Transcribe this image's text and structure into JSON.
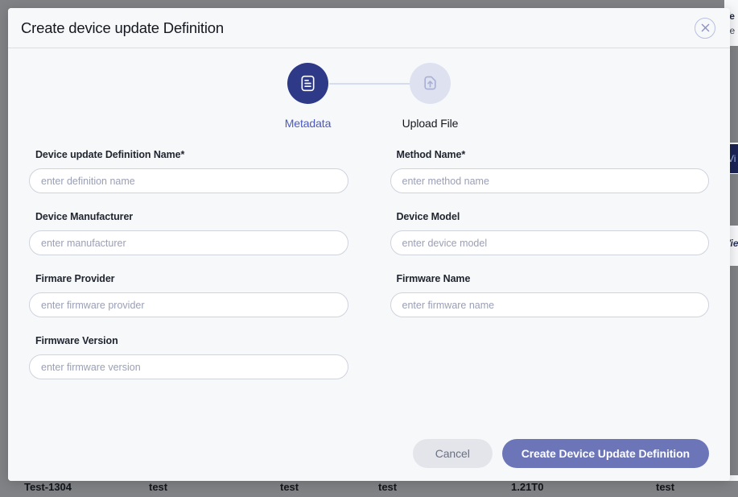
{
  "modal": {
    "title": "Create device update Definition",
    "close_icon": "close-circle-icon"
  },
  "stepper": {
    "steps": [
      {
        "label": "Metadata",
        "icon": "document-icon",
        "state": "active"
      },
      {
        "label": "Upload File",
        "icon": "upload-file-icon",
        "state": "inactive"
      }
    ]
  },
  "form": {
    "fields": [
      {
        "label": "Device update Definition Name*",
        "placeholder": "enter definition name",
        "value": "",
        "name": "definition-name"
      },
      {
        "label": "Method Name*",
        "placeholder": "enter method name",
        "value": "",
        "name": "method-name"
      },
      {
        "label": "Device Manufacturer",
        "placeholder": "enter manufacturer",
        "value": "",
        "name": "device-manufacturer"
      },
      {
        "label": "Device Model",
        "placeholder": "enter device model",
        "value": "",
        "name": "device-model"
      },
      {
        "label": "Firmare Provider",
        "placeholder": "enter firmware provider",
        "value": "",
        "name": "firmware-provider"
      },
      {
        "label": "Firmware Name",
        "placeholder": "enter firmware name",
        "value": "",
        "name": "firmware-name"
      },
      {
        "label": "Firmware Version",
        "placeholder": "enter firmware version",
        "value": "",
        "name": "firmware-version"
      }
    ]
  },
  "footer": {
    "cancel_label": "Cancel",
    "submit_label": "Create Device Update Definition"
  },
  "background": {
    "text_snip_1": "Te",
    "text_snip_2": "ne",
    "button_snip": "Vi",
    "link_snip": "Vie",
    "table_row": [
      "Test-1304",
      "test",
      "test",
      "test",
      "1.21T0",
      "test"
    ]
  },
  "colors": {
    "accent": "#2e3a87",
    "primary_button": "#6b75b8",
    "step_active_label": "#4a5ac0",
    "overlay": "#808285",
    "modal_bg": "#f7f8fa"
  }
}
